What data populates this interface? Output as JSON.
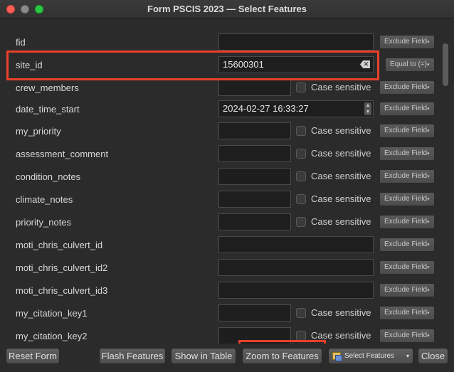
{
  "window": {
    "title": "Form PSCIS 2023 — Select Features"
  },
  "rows": [
    {
      "label": "fid",
      "value": "",
      "kind": "wide",
      "case_sensitive": false,
      "filter": "Exclude Field"
    },
    {
      "label": "site_id",
      "value": "15600301",
      "kind": "wide-clear",
      "case_sensitive": false,
      "filter": "Equal to (=)"
    },
    {
      "label": "crew_members",
      "value": "",
      "kind": "short",
      "case_sensitive": true,
      "filter": "Exclude Field"
    },
    {
      "label": "date_time_start",
      "value": "2024-02-27 16:33:27",
      "kind": "date",
      "case_sensitive": false,
      "filter": "Exclude Field"
    },
    {
      "label": "my_priority",
      "value": "",
      "kind": "short",
      "case_sensitive": true,
      "filter": "Exclude Field"
    },
    {
      "label": "assessment_comment",
      "value": "",
      "kind": "short",
      "case_sensitive": true,
      "filter": "Exclude Field"
    },
    {
      "label": "condition_notes",
      "value": "",
      "kind": "short",
      "case_sensitive": true,
      "filter": "Exclude Field"
    },
    {
      "label": "climate_notes",
      "value": "",
      "kind": "short",
      "case_sensitive": true,
      "filter": "Exclude Field"
    },
    {
      "label": "priority_notes",
      "value": "",
      "kind": "short",
      "case_sensitive": true,
      "filter": "Exclude Field"
    },
    {
      "label": "moti_chris_culvert_id",
      "value": "",
      "kind": "wide",
      "case_sensitive": false,
      "filter": "Exclude Field"
    },
    {
      "label": "moti_chris_culvert_id2",
      "value": "",
      "kind": "wide",
      "case_sensitive": false,
      "filter": "Exclude Field"
    },
    {
      "label": "moti_chris_culvert_id3",
      "value": "",
      "kind": "wide",
      "case_sensitive": false,
      "filter": "Exclude Field"
    },
    {
      "label": "my_citation_key1",
      "value": "",
      "kind": "short",
      "case_sensitive": true,
      "filter": "Exclude Field"
    },
    {
      "label": "my_citation_key2",
      "value": "",
      "kind": "short",
      "case_sensitive": true,
      "filter": "Exclude Field"
    }
  ],
  "case_sensitive_label": "Case sensitive",
  "footer": {
    "reset": "Reset Form",
    "flash": "Flash Features",
    "show_table": "Show in Table",
    "zoom": "Zoom to Features",
    "select": "Select Features",
    "close": "Close"
  },
  "colors": {
    "highlight": "#e8402a",
    "background": "#2b2b2b"
  }
}
